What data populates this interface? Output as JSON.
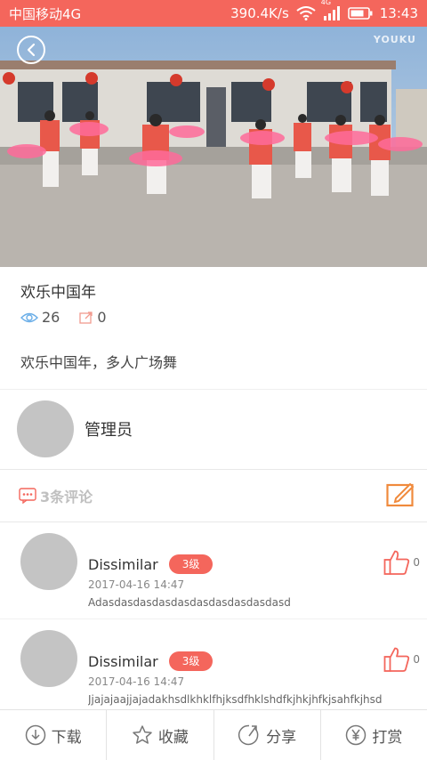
{
  "status_bar": {
    "carrier": "中国移动4G",
    "speed": "390.4K/s",
    "network_tag": "4G",
    "time": "13:43"
  },
  "video": {
    "watermark": "YOUKU"
  },
  "post": {
    "title": "欢乐中国年",
    "views": "26",
    "shares": "0",
    "description": "欢乐中国年，多人广场舞"
  },
  "author": {
    "name": "管理员"
  },
  "comments_header": {
    "label": "3条评论"
  },
  "comments": [
    {
      "user": "Dissimilar",
      "level": "3级",
      "time": "2017-04-16 14:47",
      "text": "Adasdasdasdasdasdasdasdasdasdasd",
      "likes": "0"
    },
    {
      "user": "Dissimilar",
      "level": "3级",
      "time": "2017-04-16 14:47",
      "text": "Jjajajaajjajadakhsdlkhklfhjksdfhklshdfkjhkjhfkjsahfkjhsd",
      "likes": "0"
    }
  ],
  "bottom_bar": {
    "download": "下载",
    "favorite": "收藏",
    "share": "分享",
    "reward": "打赏"
  },
  "colors": {
    "accent": "#f4665c",
    "edit_icon": "#f08a3c"
  }
}
